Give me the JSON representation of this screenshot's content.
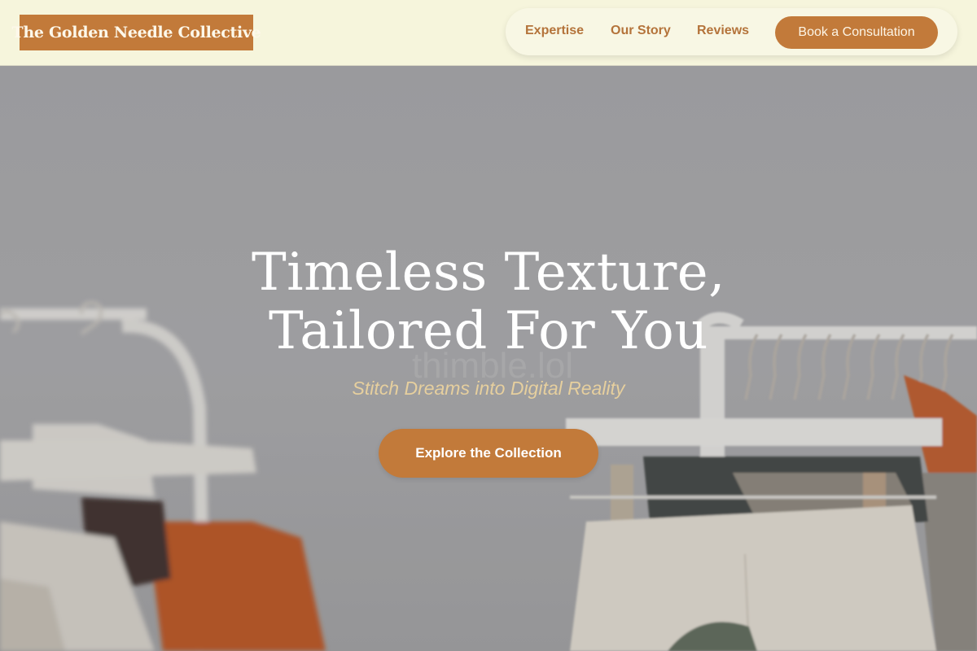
{
  "brand": {
    "name": "The Golden Needle Collective",
    "accent_color": "#c27a3a"
  },
  "nav": {
    "links": [
      "Expertise",
      "Our Story",
      "Reviews"
    ],
    "cta_label": "Book a Consultation"
  },
  "hero": {
    "title_line1": "Timeless Texture,",
    "title_line2": "Tailored For You",
    "subtitle": "Stitch Dreams into Digital Reality",
    "cta_label": "Explore the Collection",
    "watermark": "thimble.lol",
    "image": "photo of white clothing racks with hangers, rust and cream garments"
  }
}
